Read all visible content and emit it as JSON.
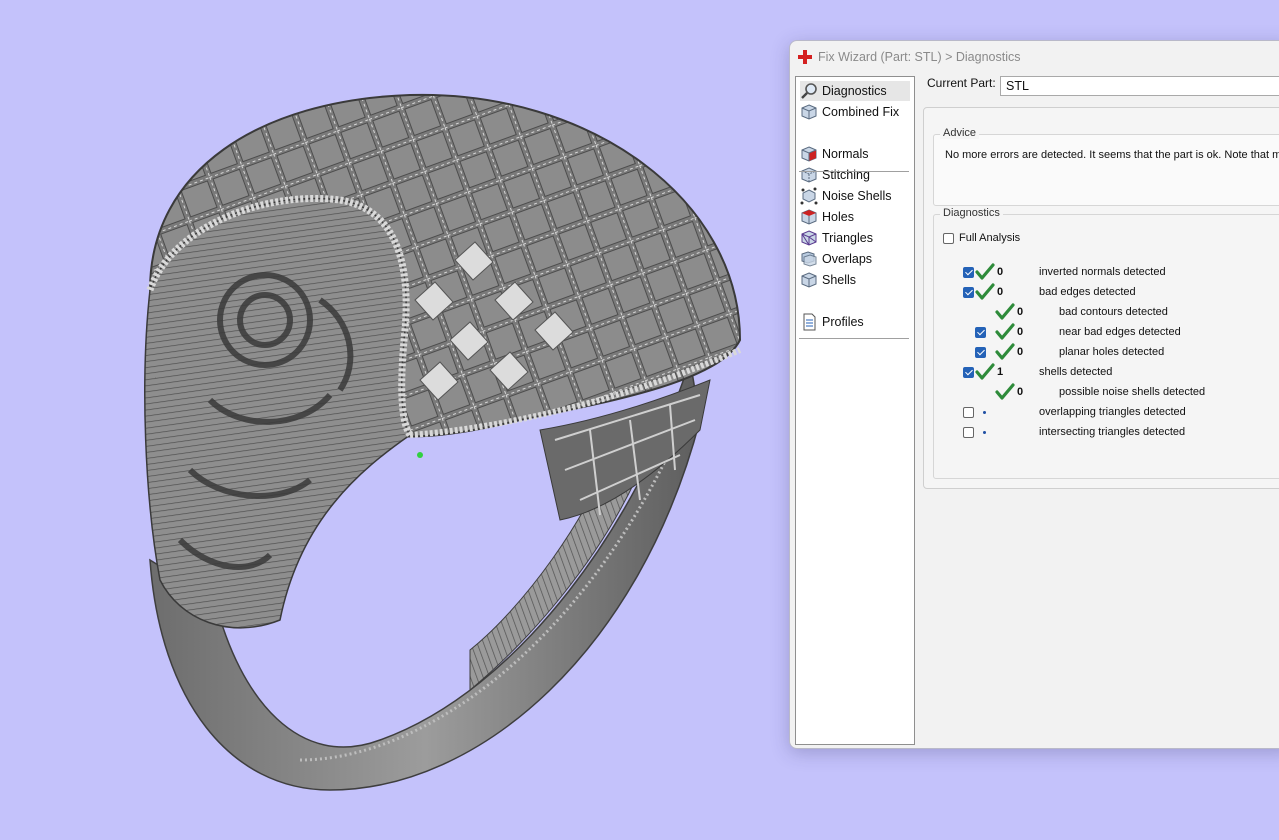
{
  "window": {
    "title": "Fix Wizard (Part: STL) > Diagnostics"
  },
  "nav": {
    "items": [
      {
        "label": "Diagnostics",
        "icon": "magnifier-icon",
        "selected": true
      },
      {
        "label": "Combined Fix",
        "icon": "cube-icon"
      },
      {
        "label": "Normals",
        "icon": "normals-cube-icon"
      },
      {
        "label": "Stitching",
        "icon": "stitching-cube-icon"
      },
      {
        "label": "Noise Shells",
        "icon": "noise-shells-icon"
      },
      {
        "label": "Holes",
        "icon": "holes-cube-icon"
      },
      {
        "label": "Triangles",
        "icon": "triangles-cube-icon"
      },
      {
        "label": "Overlaps",
        "icon": "overlaps-cube-icon"
      },
      {
        "label": "Shells",
        "icon": "shells-cube-icon"
      },
      {
        "label": "Profiles",
        "icon": "document-icon"
      }
    ]
  },
  "current_part": {
    "label": "Current Part:",
    "value": "STL"
  },
  "advice": {
    "group_label": "Advice",
    "text": "No more errors are detected. It seems that the part is ok. Note that more"
  },
  "diagnostics": {
    "group_label": "Diagnostics",
    "full_analysis_label": "Full Analysis",
    "full_analysis_checked": false,
    "rows": [
      {
        "checked": true,
        "status": "ok",
        "count": "0",
        "label": "inverted normals detected"
      },
      {
        "checked": true,
        "status": "ok",
        "count": "0",
        "label": "bad edges detected"
      },
      {
        "status": "ok",
        "count": "0",
        "label": "bad contours detected"
      },
      {
        "checked": true,
        "status": "ok",
        "count": "0",
        "label": "near bad edges detected"
      },
      {
        "checked": true,
        "status": "ok",
        "count": "0",
        "label": "planar holes detected"
      },
      {
        "checked": true,
        "status": "ok",
        "count": "1",
        "label": "shells detected"
      },
      {
        "status": "ok",
        "count": "0",
        "label": "possible noise shells detected"
      },
      {
        "checked": false,
        "status": "not-run",
        "count": "",
        "label": "overlapping triangles detected"
      },
      {
        "checked": false,
        "status": "not-run",
        "count": "",
        "label": "intersecting triangles detected"
      }
    ]
  },
  "colors": {
    "viewport_background": "#c4c2fb",
    "checkbox_accent": "#2462b7",
    "ok_tick": "#2e8b3a"
  }
}
